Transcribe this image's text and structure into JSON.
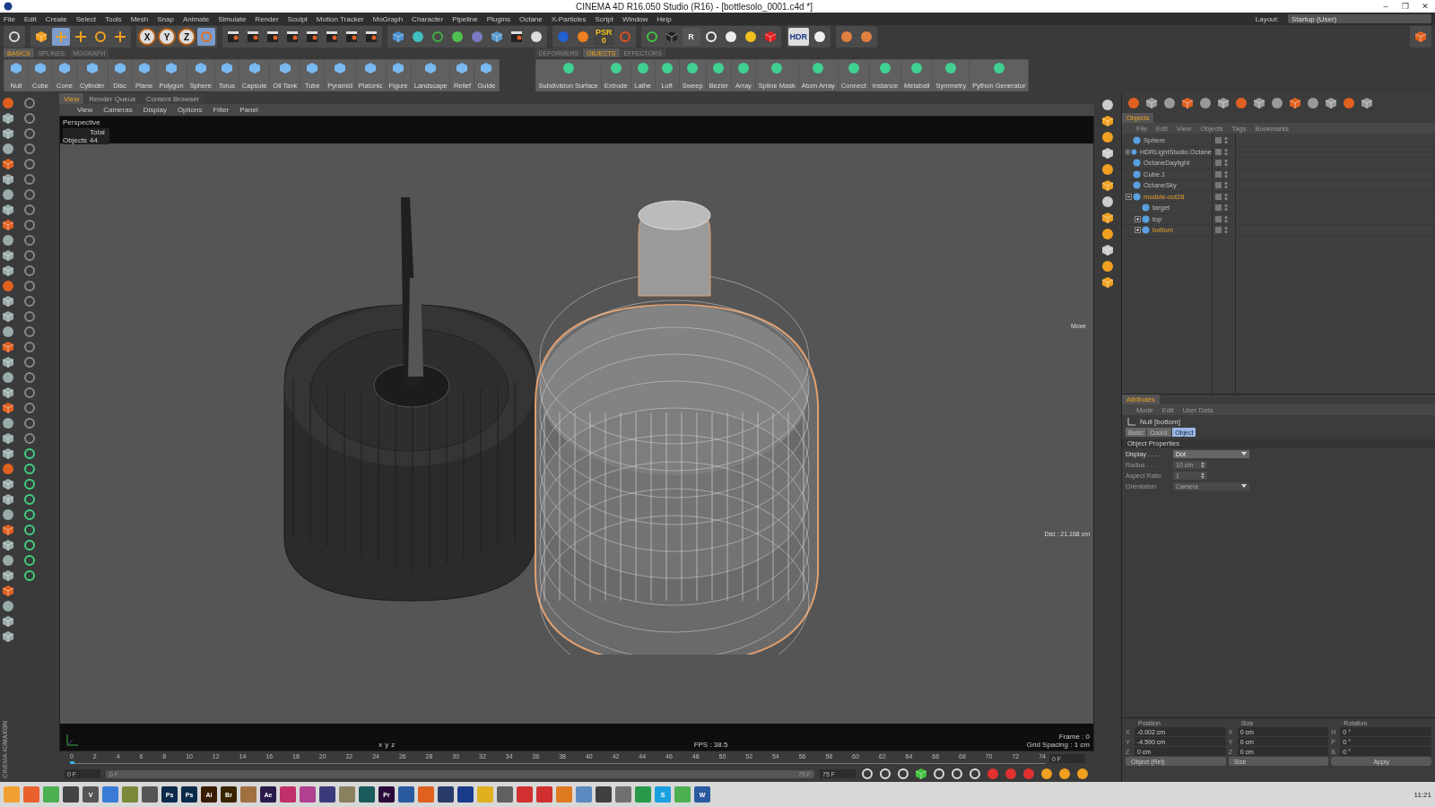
{
  "window": {
    "title": "CINEMA 4D R16.050 Studio (R16) - [bottlesolo_0001.c4d *]",
    "controls": [
      "–",
      "❐",
      "✕"
    ]
  },
  "menu": [
    "File",
    "Edit",
    "Create",
    "Select",
    "Tools",
    "Mesh",
    "Snap",
    "Animate",
    "Simulate",
    "Render",
    "Sculpt",
    "Motion Tracker",
    "MoGraph",
    "Character",
    "Pipeline",
    "Plugins",
    "Octane",
    "X-Particles",
    "Script",
    "Window",
    "Help"
  ],
  "layout": {
    "label": "Layout:",
    "value": "Startup (User)"
  },
  "toolbar": {
    "axes": [
      "X",
      "Y",
      "Z"
    ],
    "psr": [
      "PSR",
      "0"
    ],
    "render_letter": "R",
    "hdr": "HDR"
  },
  "palette_left": {
    "tabs": [
      {
        "label": "BASICS",
        "selected": true
      },
      {
        "label": "SPLINES",
        "selected": false
      },
      {
        "label": "MOGRAPH",
        "selected": false
      }
    ],
    "items": [
      "Null",
      "Cube",
      "Cone",
      "Cylinder",
      "Disc",
      "Plane",
      "Polygon",
      "Sphere",
      "Torus",
      "Capsule",
      "Oil Tank",
      "Tube",
      "Pyramid",
      "Platonic",
      "Figure",
      "Landscape",
      "Relief",
      "Guide"
    ]
  },
  "palette_right": {
    "tabs": [
      {
        "label": "DEFORMERS",
        "selected": false
      },
      {
        "label": "OBJECTS",
        "selected": true
      },
      {
        "label": "EFFECTORS",
        "selected": false
      }
    ],
    "items": [
      "Subdivision Surface",
      "Extrude",
      "Lathe",
      "Loft",
      "Sweep",
      "Bezier",
      "Array",
      "Spline Mask",
      "Atom Array",
      "Connect",
      "Instance",
      "Metaball",
      "Symmetry",
      "Python Generator"
    ]
  },
  "viewport": {
    "tabs": [
      {
        "label": "View",
        "selected": true
      },
      {
        "label": "Render Queue",
        "selected": false
      },
      {
        "label": "Content Browser",
        "selected": false
      }
    ],
    "menu": [
      "View",
      "Cameras",
      "Display",
      "Options",
      "Filter",
      "Panel"
    ],
    "camera": "Perspective",
    "stats_header": "Total",
    "stats_label": "Objects",
    "stats_value": "44",
    "tool": "Move",
    "distance": "Dist : 21.168 cm",
    "fps": "FPS : 38.5",
    "frame": "Frame : 0",
    "grid": "Grid Spacing : 1 cm",
    "axis_labels": [
      "x",
      "y",
      "z"
    ]
  },
  "timeline": {
    "ticks": [
      "0",
      "2",
      "4",
      "6",
      "8",
      "10",
      "12",
      "14",
      "16",
      "18",
      "20",
      "22",
      "24",
      "26",
      "28",
      "30",
      "32",
      "34",
      "36",
      "38",
      "40",
      "42",
      "44",
      "46",
      "48",
      "50",
      "52",
      "54",
      "56",
      "58",
      "60",
      "62",
      "64",
      "66",
      "68",
      "70",
      "72",
      "74"
    ],
    "current": "0 F",
    "start": "0 F",
    "range_start": "0 F",
    "range_end": "75 F",
    "end": "75 F",
    "level": 0.0
  },
  "logo": [
    "MAXON",
    "CINEMA 4D"
  ],
  "objects": {
    "tab": "Objects",
    "menu": [
      "File",
      "Edit",
      "View",
      "Objects",
      "Tags",
      "Bookmarks"
    ],
    "items": [
      {
        "name": "Sphere",
        "selected": false
      },
      {
        "name": "HDRLightStudio.Octane",
        "selected": false,
        "expanded": false
      },
      {
        "name": "OctaneDaylight",
        "selected": false
      },
      {
        "name": "Cube.1",
        "selected": false
      },
      {
        "name": "OctaneSky",
        "selected": false
      },
      {
        "name": "module-oct28",
        "selected": true,
        "expanded": true,
        "children": [
          {
            "name": "target",
            "selected": false
          },
          {
            "name": "top",
            "selected": false,
            "expanded": false
          },
          {
            "name": "bottom",
            "selected": true,
            "expanded": false
          }
        ]
      }
    ]
  },
  "attributes": {
    "tab": "Attributes",
    "menu": [
      "Mode",
      "Edit",
      "User Data"
    ],
    "object": "Null [bottom]",
    "tabs": [
      {
        "label": "Basic",
        "selected": false
      },
      {
        "label": "Coord.",
        "selected": false
      },
      {
        "label": "Object",
        "selected": true
      }
    ],
    "section": "Object Properties",
    "fields": [
      {
        "label": "Display . . . .",
        "value": "Dot",
        "kind": "dropdown",
        "disabled": false
      },
      {
        "label": "Radius . . . . .",
        "value": "10 cm",
        "kind": "number",
        "disabled": true
      },
      {
        "label": "Aspect Ratio",
        "value": "1",
        "kind": "number",
        "disabled": true
      },
      {
        "label": "Orientation",
        "value": "Camera",
        "kind": "dropdown",
        "disabled": true
      }
    ]
  },
  "coordinates": {
    "headers": [
      "Position",
      "Size",
      "Rotation"
    ],
    "rows": [
      [
        {
          "axis": "X",
          "value": "-0.002 cm"
        },
        {
          "axis": "X",
          "value": "0 cm"
        },
        {
          "axis": "H",
          "value": "0 °"
        }
      ],
      [
        {
          "axis": "Y",
          "value": "-4.590 cm"
        },
        {
          "axis": "Y",
          "value": "0 cm"
        },
        {
          "axis": "P",
          "value": "0 °"
        }
      ],
      [
        {
          "axis": "Z",
          "value": "0 cm"
        },
        {
          "axis": "Z",
          "value": "0 cm"
        },
        {
          "axis": "B",
          "value": "0 °"
        }
      ]
    ],
    "mode": "Object (Rel)",
    "size_mode": "Size",
    "apply": "Apply"
  },
  "taskbar": {
    "apps": [
      {
        "color": "#f0a030"
      },
      {
        "color": "#e8612c"
      },
      {
        "color": "#4caf50"
      },
      {
        "color": "#444444"
      },
      {
        "label": "V",
        "color": "#555555"
      },
      {
        "color": "#3a7bd5"
      },
      {
        "color": "#7a8a3a"
      },
      {
        "color": "#555555"
      },
      {
        "label": "Ps",
        "color": "#0b2a4a"
      },
      {
        "label": "Ps",
        "color": "#0b2a4a"
      },
      {
        "label": "Ai",
        "color": "#3a1d00"
      },
      {
        "label": "Br",
        "color": "#3a2400"
      },
      {
        "color": "#a07040"
      },
      {
        "label": "Ae",
        "color": "#2a1a4a"
      },
      {
        "color": "#c0306a"
      },
      {
        "color": "#b04090"
      },
      {
        "color": "#3a3a7a"
      },
      {
        "color": "#8a8060"
      },
      {
        "color": "#1a5a5a"
      },
      {
        "label": "Pr",
        "color": "#2a0a3a"
      },
      {
        "color": "#2a5aa0"
      },
      {
        "color": "#e06020"
      },
      {
        "color": "#2a3a6a"
      },
      {
        "color": "#1a3a8a"
      },
      {
        "color": "#e0b020"
      },
      {
        "color": "#606060"
      },
      {
        "color": "#d03030"
      },
      {
        "color": "#d03030"
      },
      {
        "color": "#e07a20"
      },
      {
        "color": "#5a8ac0"
      },
      {
        "color": "#404040"
      },
      {
        "color": "#707070"
      },
      {
        "color": "#2a9a4a"
      },
      {
        "label": "S",
        "color": "#1aa0e0"
      },
      {
        "color": "#4caf50"
      },
      {
        "label": "W",
        "color": "#2a5aa0"
      }
    ],
    "time": "11:21"
  }
}
